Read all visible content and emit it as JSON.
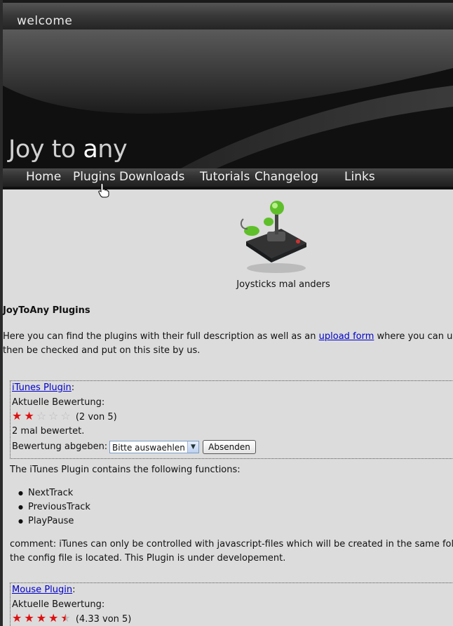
{
  "header": {
    "welcome": "welcome",
    "title_parts": [
      "Joy to ",
      "a",
      "ny"
    ]
  },
  "nav": {
    "items": [
      "Home",
      "Plugins",
      "Downloads",
      "Tutorials",
      "Changelog",
      "Links"
    ]
  },
  "logo": {
    "icon": "joystick-icon",
    "caption": "Joysticks mal anders"
  },
  "page": {
    "heading": "JoyToAny Plugins",
    "intro_before": "Here you can find the plugins with their full description as well as an ",
    "intro_link": "upload form",
    "intro_after": " where you can uploa",
    "intro_line2": "then be checked and put on this site by us."
  },
  "plugins": [
    {
      "name": "iTunes Plugin",
      "rating_label": "Aktuelle Bewertung:",
      "rating_value": 2,
      "rating_text": "(2 von 5)",
      "votes": "2 mal bewertet.",
      "vote_label": "Bewertung abgeben:",
      "select_value": "Bitte auswaehlen",
      "submit_label": "Absenden",
      "description": "The iTunes Plugin contains the following functions:",
      "functions": [
        "NextTrack",
        "PreviousTrack",
        "PlayPause"
      ],
      "comment_line1": "comment: iTunes can only be controlled with javascript-files which will be created in the same folde",
      "comment_line2": "the config file is located. This Plugin is under developement."
    },
    {
      "name": "Mouse Plugin",
      "rating_label": "Aktuelle Bewertung:",
      "rating_value": 4.33,
      "rating_text": "(4.33 von 5)"
    }
  ],
  "colors": {
    "link": "#0000cc",
    "star": "#dd1111",
    "content_bg": "#dcdcdc"
  }
}
